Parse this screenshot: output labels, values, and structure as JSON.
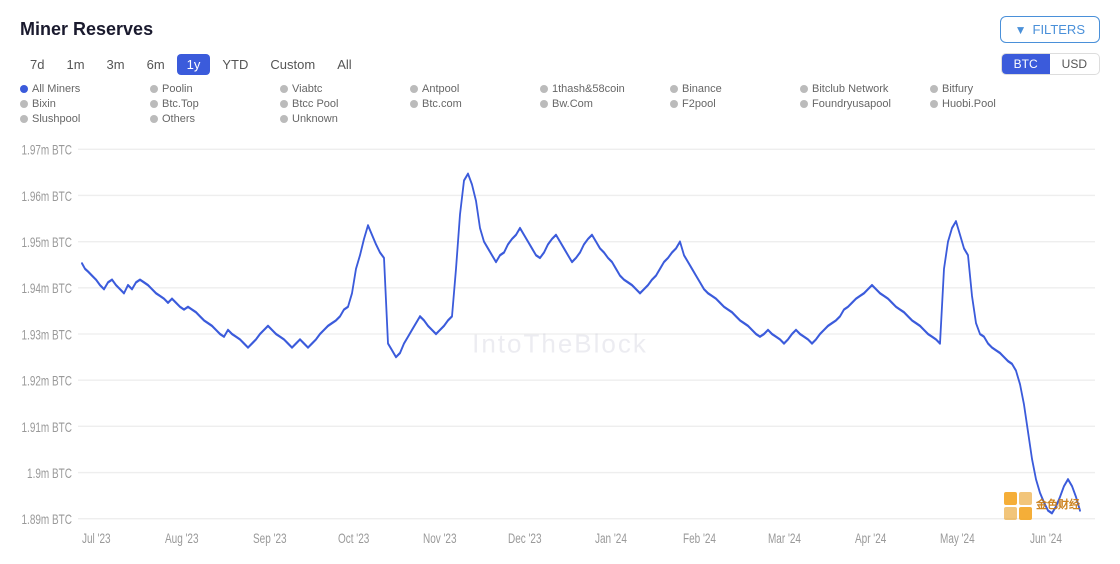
{
  "header": {
    "title": "Miner Reserves",
    "filters_label": "FILTERS"
  },
  "time_periods": [
    {
      "label": "7d",
      "id": "7d",
      "active": false
    },
    {
      "label": "1m",
      "id": "1m",
      "active": false
    },
    {
      "label": "3m",
      "id": "3m",
      "active": false
    },
    {
      "label": "6m",
      "id": "6m",
      "active": false
    },
    {
      "label": "1y",
      "id": "1y",
      "active": true
    },
    {
      "label": "YTD",
      "id": "ytd",
      "active": false
    },
    {
      "label": "Custom",
      "id": "custom",
      "active": false
    },
    {
      "label": "All",
      "id": "all",
      "active": false
    }
  ],
  "currency": {
    "options": [
      "BTC",
      "USD"
    ],
    "active": "BTC"
  },
  "legend": [
    {
      "label": "All Miners",
      "type": "all-miners"
    },
    {
      "label": "Poolin",
      "type": "gray"
    },
    {
      "label": "Viabtc",
      "type": "gray"
    },
    {
      "label": "Antpool",
      "type": "gray"
    },
    {
      "label": "1thash&58coin",
      "type": "gray"
    },
    {
      "label": "Binance",
      "type": "gray"
    },
    {
      "label": "Bitclub Network",
      "type": "gray"
    },
    {
      "label": "Bitfury",
      "type": "gray"
    },
    {
      "label": "Bixin",
      "type": "gray"
    },
    {
      "label": "Btc.Top",
      "type": "gray"
    },
    {
      "label": "Btcc Pool",
      "type": "gray"
    },
    {
      "label": "Btc.com",
      "type": "gray"
    },
    {
      "label": "Bw.Com",
      "type": "gray"
    },
    {
      "label": "F2pool",
      "type": "gray"
    },
    {
      "label": "Foundryusapool",
      "type": "gray"
    },
    {
      "label": "Huobi.Pool",
      "type": "gray"
    },
    {
      "label": "Slushpool",
      "type": "gray"
    },
    {
      "label": "Others",
      "type": "gray"
    },
    {
      "label": "Unknown",
      "type": "gray"
    }
  ],
  "y_axis_labels": [
    "1.97m BTC",
    "1.96m BTC",
    "1.95m BTC",
    "1.94m BTC",
    "1.93m BTC",
    "1.92m BTC",
    "1.91m BTC",
    "1.9m BTC",
    "1.89m BTC"
  ],
  "x_axis_labels": [
    "Jul '23",
    "Aug '23",
    "Sep '23",
    "Oct '23",
    "Nov '23",
    "Dec '23",
    "Jan '24",
    "Feb '24",
    "Mar '24",
    "Apr '24",
    "May '24",
    "Jun '24"
  ],
  "watermark": "IntoTheBlock",
  "brand": {
    "text_line1": "金色财经",
    "color": "#f5a623"
  }
}
